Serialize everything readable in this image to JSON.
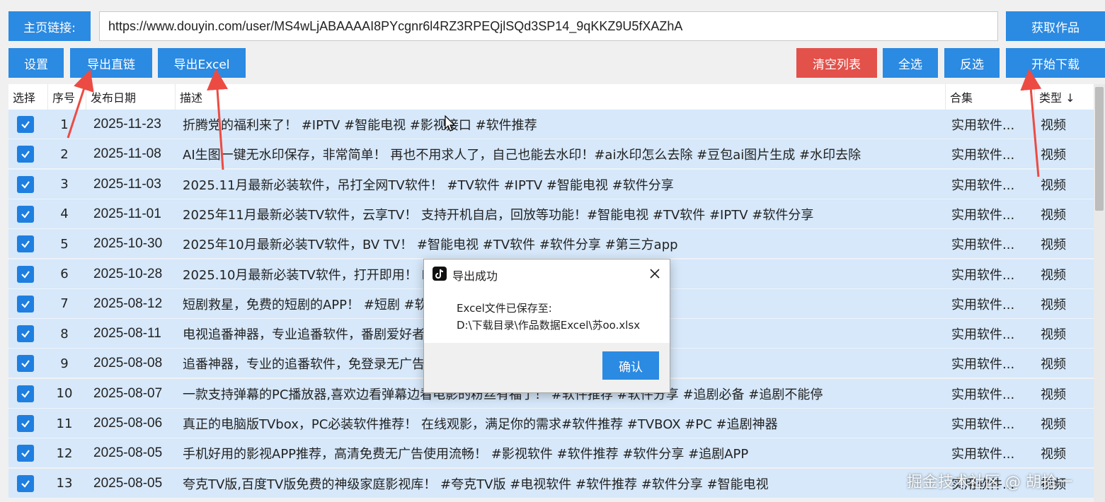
{
  "toolbar": {
    "home_label": "主页链接:",
    "url_value": "https://www.douyin.com/user/MS4wLjABAAAAI8PYcgnr6l4RZ3RPEQjlSQd3SP14_9qKKZ9U5fXAZhA",
    "fetch": "获取作品",
    "settings": "设置",
    "export_link": "导出直链",
    "export_excel": "导出Excel",
    "clear": "清空列表",
    "select_all": "全选",
    "invert": "反选",
    "download": "开始下载"
  },
  "table": {
    "headers": {
      "select": "选择",
      "index": "序号",
      "date": "发布日期",
      "desc": "描述",
      "collection": "合集",
      "type": "类型 ↓"
    },
    "rows": [
      {
        "index": "1",
        "date": "2025-11-23",
        "desc": "折腾党的福利来了！ #IPTV #智能电视 #影视接口 #软件推荐",
        "collection": "实用软件...",
        "type": "视频",
        "checked": true
      },
      {
        "index": "2",
        "date": "2025-11-08",
        "desc": "AI生图一键无水印保存，非常简单！ 再也不用求人了，自己也能去水印！#ai水印怎么去除 #豆包ai图片生成 #水印去除",
        "collection": "实用软件...",
        "type": "视频",
        "checked": true
      },
      {
        "index": "3",
        "date": "2025-11-03",
        "desc": "2025.11月最新必装软件，吊打全网TV软件！ #TV软件 #IPTV #智能电视 #软件分享",
        "collection": "实用软件...",
        "type": "视频",
        "checked": true
      },
      {
        "index": "4",
        "date": "2025-11-01",
        "desc": "2025年11月最新必装TV软件，云享TV！ 支持开机自启，回放等功能！#智能电视 #TV软件 #IPTV #软件分享",
        "collection": "实用软件...",
        "type": "视频",
        "checked": true
      },
      {
        "index": "5",
        "date": "2025-10-30",
        "desc": "2025年10月最新必装TV软件，BV TV！ #智能电视 #TV软件 #软件分享 #第三方app",
        "collection": "实用软件...",
        "type": "视频",
        "checked": true
      },
      {
        "index": "6",
        "date": "2025-10-28",
        "desc": "2025.10月最新必装TV软件，打开即用！                                        PTV #智能电视 #软件分享",
        "collection": "实用软件...",
        "type": "视频",
        "checked": true
      },
      {
        "index": "7",
        "date": "2025-08-12",
        "desc": "短剧救星，免费的短剧的APP！ #短剧 #软                                              丽的转身",
        "collection": "实用软件...",
        "type": "视频",
        "checked": true
      },
      {
        "index": "8",
        "date": "2025-08-11",
        "desc": "电视追番神器，专业追番软件，番剧爱好者                                           软件推荐",
        "collection": "实用软件...",
        "type": "视频",
        "checked": true
      },
      {
        "index": "9",
        "date": "2025-08-08",
        "desc": "追番神器，专业的追番软件，免登录无广告                                           番软件推荐 #软件推荐",
        "collection": "实用软件...",
        "type": "视频",
        "checked": true
      },
      {
        "index": "10",
        "date": "2025-08-07",
        "desc": "一款支持弹幕的PC播放器,喜欢边看弹幕边看电影的粉丝有福了！ #软件推荐 #软件分享 #追剧必备 #追剧不能停",
        "collection": "实用软件...",
        "type": "视频",
        "checked": true
      },
      {
        "index": "11",
        "date": "2025-08-06",
        "desc": "真正的电脑版TVbox，PC必装软件推荐！ 在线观影，满足你的需求#软件推荐 #TVBOX #PC #追剧神器",
        "collection": "实用软件...",
        "type": "视频",
        "checked": true
      },
      {
        "index": "12",
        "date": "2025-08-05",
        "desc": "手机好用的影视APP推荐，高清免费无广告使用流畅！ #影视软件 #软件推荐 #软件分享 #追剧APP",
        "collection": "实用软件...",
        "type": "视频",
        "checked": true
      },
      {
        "index": "13",
        "date": "2025-08-05",
        "desc": "夸克TV版,百度TV版免费的神级家庭影视库！ #夸克TV版 #电视软件 #软件推荐 #软件分享 #智能电视",
        "collection": "实用软件...",
        "type": "视频",
        "checked": true
      }
    ]
  },
  "dialog": {
    "title": "导出成功",
    "line1": "Excel文件已保存至:",
    "line2": "D:\\下载目录\\作品数据Excel\\苏oo.xlsx",
    "ok": "确认"
  },
  "watermark": "掘金技术社区 @ 胡拾一",
  "colors": {
    "primary": "#2b8ae2",
    "danger": "#e3514b",
    "row_selected": "#d6e8fa",
    "annotation_arrow": "#ec4b43"
  }
}
